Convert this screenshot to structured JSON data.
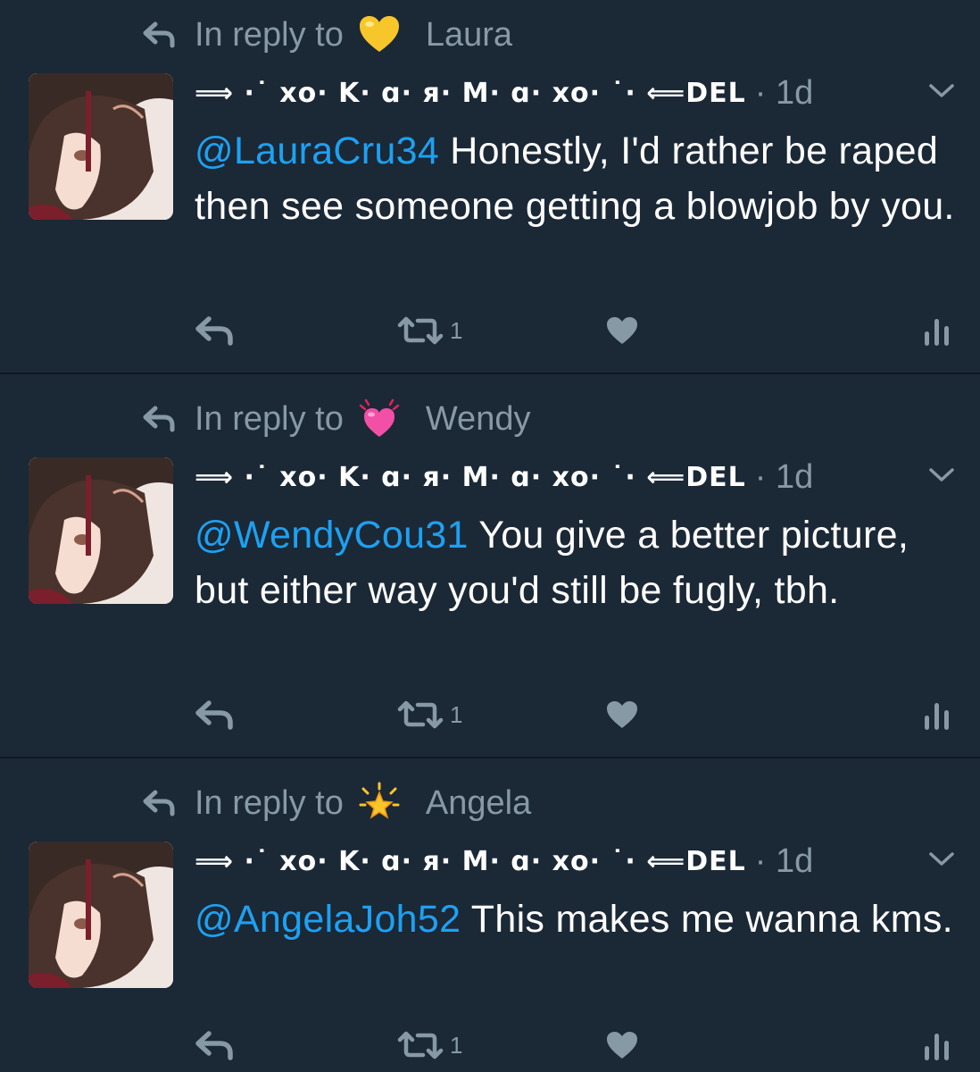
{
  "colors": {
    "background": "#1b2836",
    "divider": "#0f1822",
    "muted": "#8899a6",
    "mention": "#1da1f2",
    "text": "#ffffff"
  },
  "tweets": [
    {
      "reply_prefix": "In reply to",
      "reply_emoji": "yellow-heart-icon",
      "reply_name": "Laura",
      "display_name": "⟹ ·˙ xo· K· ɑ· я· M· ɑ· xo· ˙· ⟸DEL",
      "timestamp": "· 1d",
      "mention": "@LauraCru34",
      "text": " Honestly, I'd rather be raped then see someone getting a blowjob by you.",
      "retweet_count": "1"
    },
    {
      "reply_prefix": "In reply to",
      "reply_emoji": "growing-heart-icon",
      "reply_name": "Wendy",
      "display_name": "⟹ ·˙ xo· K· ɑ· я· M· ɑ· xo· ˙· ⟸DEL",
      "timestamp": "· 1d",
      "mention": "@WendyCou31",
      "text": " You give a better picture, but either way you'd still be fugly, tbh.",
      "retweet_count": "1"
    },
    {
      "reply_prefix": "In reply to",
      "reply_emoji": "glowing-star-icon",
      "reply_name": "Angela",
      "display_name": "⟹ ·˙ xo· K· ɑ· я· M· ɑ· xo· ˙· ⟸DEL",
      "timestamp": "· 1d",
      "mention": "@AngelaJoh52",
      "text": " This makes me wanna kms.",
      "retweet_count": "1"
    }
  ]
}
